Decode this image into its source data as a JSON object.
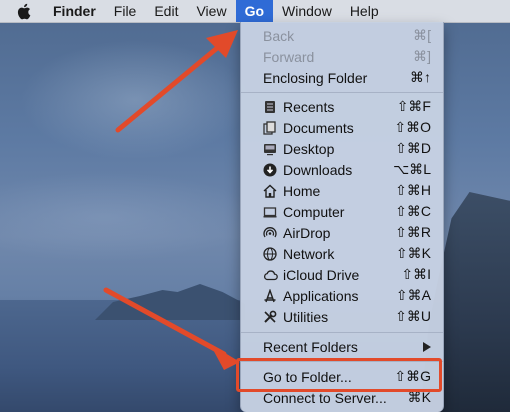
{
  "menubar": {
    "app_name": "Finder",
    "items": [
      "File",
      "Edit",
      "View",
      "Go",
      "Window",
      "Help"
    ]
  },
  "go_menu": {
    "back": {
      "label": "Back",
      "shortcut": "⌘["
    },
    "forward": {
      "label": "Forward",
      "shortcut": "⌘]"
    },
    "enclosing": {
      "label": "Enclosing Folder",
      "shortcut": "⌘↑"
    },
    "locations": [
      {
        "label": "Recents",
        "shortcut": "⇧⌘F",
        "icon": "recents-icon"
      },
      {
        "label": "Documents",
        "shortcut": "⇧⌘O",
        "icon": "documents-icon"
      },
      {
        "label": "Desktop",
        "shortcut": "⇧⌘D",
        "icon": "desktop-icon"
      },
      {
        "label": "Downloads",
        "shortcut": "⌥⌘L",
        "icon": "downloads-icon"
      },
      {
        "label": "Home",
        "shortcut": "⇧⌘H",
        "icon": "home-icon"
      },
      {
        "label": "Computer",
        "shortcut": "⇧⌘C",
        "icon": "computer-icon"
      },
      {
        "label": "AirDrop",
        "shortcut": "⇧⌘R",
        "icon": "airdrop-icon"
      },
      {
        "label": "Network",
        "shortcut": "⇧⌘K",
        "icon": "network-icon"
      },
      {
        "label": "iCloud Drive",
        "shortcut": "⇧⌘I",
        "icon": "icloud-icon"
      },
      {
        "label": "Applications",
        "shortcut": "⇧⌘A",
        "icon": "applications-icon"
      },
      {
        "label": "Utilities",
        "shortcut": "⇧⌘U",
        "icon": "utilities-icon"
      }
    ],
    "recent_folders": {
      "label": "Recent Folders"
    },
    "go_to_folder": {
      "label": "Go to Folder...",
      "shortcut": "⇧⌘G"
    },
    "connect": {
      "label": "Connect to Server...",
      "shortcut": "⌘K"
    }
  },
  "colors": {
    "menu_active": "#2f6bd6",
    "annotation_red": "#e24a2a"
  }
}
